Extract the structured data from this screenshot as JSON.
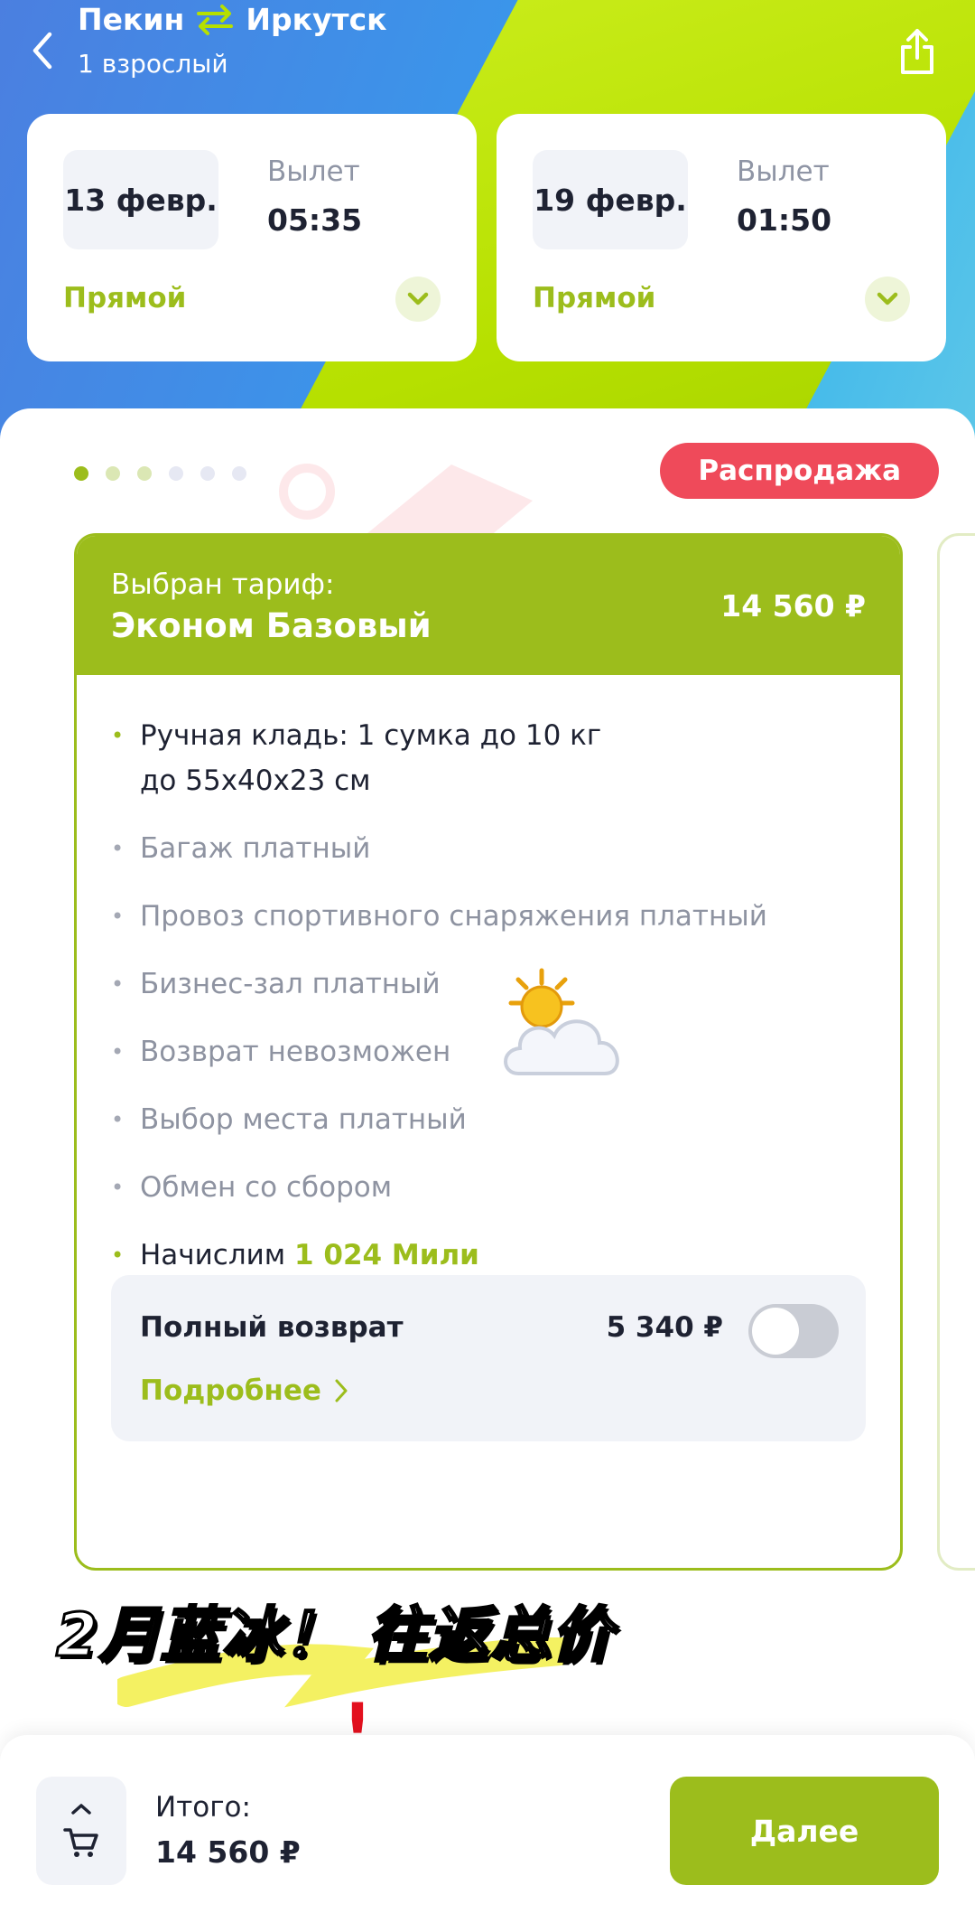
{
  "header": {
    "origin": "Пекин",
    "destination": "Иркутск",
    "passengers": "1 взрослый"
  },
  "flights": [
    {
      "date": "13 февр.",
      "departure_label": "Вылет",
      "departure_time": "05:35",
      "type": "Прямой"
    },
    {
      "date": "19 февр.",
      "departure_label": "Вылет",
      "departure_time": "01:50",
      "type": "Прямой"
    }
  ],
  "sale_badge": "Распродажа",
  "carousel": {
    "total_dots": 6,
    "active_index": 0
  },
  "tariff": {
    "selected_label": "Выбран тариф:",
    "name": "Эконом Базовый",
    "price": "14 560 ₽",
    "features": {
      "hand_luggage": "Ручная кладь: 1 сумка до 10 кг",
      "hand_luggage_size": "до 55х40х23 см",
      "baggage": "Багаж платный",
      "sport_equipment": "Провоз спортивного снаряжения платный",
      "business_lounge": "Бизнес-зал платный",
      "refund": "Возврат невозможен",
      "seat_selection": "Выбор места платный",
      "exchange": "Обмен со сбором",
      "miles_prefix": "Начислим",
      "miles_value": "1 024 Мили"
    },
    "full_refund": {
      "title": "Полный возврат",
      "price": "5 340 ₽",
      "enabled": false,
      "more_link": "Подробнее"
    }
  },
  "overlay_caption": "2月蓝冰！ 往返总价",
  "overlay_exclaim": "!",
  "footer": {
    "total_label": "Итого:",
    "total_value": "14 560 ₽",
    "next_button": "Далее"
  },
  "colors": {
    "brand_green": "#9cbd1c",
    "sale_red": "#ef4a5a",
    "hero_blue": "#3b95ea"
  }
}
